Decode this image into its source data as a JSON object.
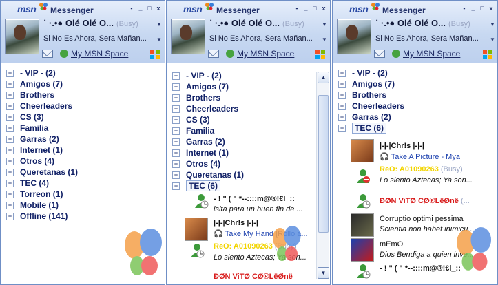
{
  "app": {
    "logo": "msn",
    "title": "Messenger",
    "window_buttons": [
      "▪",
      "_",
      "□",
      "x"
    ]
  },
  "profile": {
    "display_name": "˙ ·.•● Olé Olé O...",
    "status": "(Busy)",
    "personal_message": "Si No Es Ahora, Sera Mañan...",
    "space_link": "My MSN Space"
  },
  "win1": {
    "groups": [
      "- VIP - (2)",
      "Amigos (7)",
      "Brothers",
      "Cheerleaders",
      "CS (3)",
      "Familia",
      "Garras (2)",
      "Internet (1)",
      "Otros (4)",
      "Queretanas (1)",
      "TEC (4)",
      "Torreon (1)",
      "Mobile (1)",
      "Offline (141)"
    ]
  },
  "win2": {
    "groups": [
      "- VIP - (2)",
      "Amigos (7)",
      "Brothers",
      "Cheerleaders",
      "CS (3)",
      "Familia",
      "Garras (2)",
      "Internet (1)",
      "Otros (4)",
      "Queretanas (1)"
    ],
    "open_group": "TEC (6)",
    "contacts": [
      {
        "name": "- ! \" ( \" *--::::m@®!€l_::",
        "message": "lsita para un buen fin de ..."
      },
      {
        "name": "|-|-|Chr!s |-|-|",
        "message": "Take My Hand [Rollo a..."
      },
      {
        "name": "ReO: A01090263",
        "status": "(Busy)",
        "message": "Lo siento Aztecas; Ya son..."
      },
      {
        "name": "ÐØN ViTØ CØ®LëØnë"
      }
    ]
  },
  "win3": {
    "groups": [
      "- VIP - (2)",
      "Amigos (7)",
      "Brothers",
      "Cheerleaders",
      "Garras (2)"
    ],
    "open_group": "TEC (6)",
    "contacts": [
      {
        "name": "|-|-|Chr!s |-|-|",
        "message": "Take A Picture - Mya"
      },
      {
        "name": "ReO: A01090263",
        "status": "(Busy)",
        "message": "Lo siento Aztecas; Ya son..."
      },
      {
        "name": "ÐØN ViTØ CØ®LëØnë",
        "status": "(..."
      },
      {
        "name": "Corruptio optimi pessima",
        "message": "Scientia non habet inimicu..."
      },
      {
        "name": "mEmO",
        "message": "Dios Bendiga a quien inve..."
      },
      {
        "name": "- ! \" ( \" *--::::m@®!€l_::",
        "message": ""
      }
    ]
  },
  "colors": {
    "title_grad_top": "#e6eefb",
    "title_grad_bottom": "#bdd0ee",
    "group_text": "#102066",
    "busy_name": "#f2d400",
    "red_name": "#d81b1b"
  }
}
